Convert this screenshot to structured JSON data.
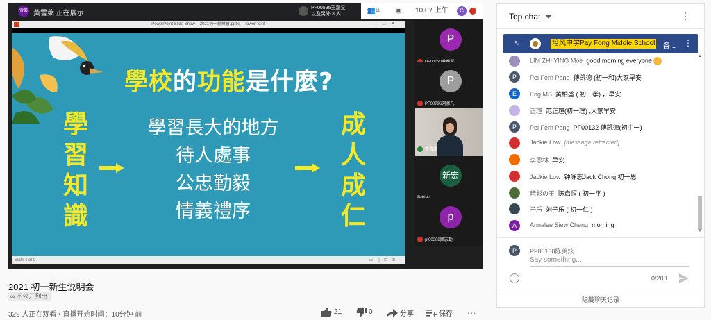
{
  "meet": {
    "presenter_avatar": "雪莱",
    "presenter_text": "黃雪萊 正在展示",
    "others_line1": "PF00596王嘉显",
    "others_line2": "以及另外 3 人",
    "people_count": "11",
    "time": "10:07 上午",
    "user_avatar": "C"
  },
  "ppt": {
    "window_title": "PowerPoint Slide Show - [2021初一新鲜會.pptx] - PowerPoint",
    "status_text": "Slide 4 of 9"
  },
  "slide": {
    "title_a": "學校",
    "title_b": "的",
    "title_c": "功能",
    "title_d": "是什麼?",
    "left_vertical": [
      "學",
      "習",
      "知",
      "識"
    ],
    "right_vertical": [
      "成",
      "人",
      "成",
      "仁"
    ],
    "lines": [
      "學習長大的地方",
      "待人處事",
      "公忠勤毅",
      "情義禮序"
    ],
    "accent_color": "#f3e928",
    "background_color": "#2f9ab7"
  },
  "tiles": [
    {
      "avatar": "P",
      "label": "PF00030蔡秀琴",
      "color": "#9c27b0"
    },
    {
      "avatar": "P",
      "label": "PF00796刘雅凡",
      "color": "#9e9e9e"
    },
    {
      "avatar": "",
      "label": "黃雪萊",
      "color": "#c9c3bd"
    },
    {
      "avatar": "新宏",
      "label": "陈新宏",
      "color": "#1b5e40"
    },
    {
      "avatar": "p",
      "label": "pf00368颜志勤",
      "color": "#8e24aa"
    }
  ],
  "video": {
    "title": "2021 初一新生说明会",
    "unlisted": "不公开列出",
    "stats": "329 人正在观看 • 直播开始时间：10分钟 前",
    "likes": "21",
    "dislikes": "0",
    "share": "分享",
    "save": "保存",
    "more": "⋯"
  },
  "chat": {
    "header": "Top chat",
    "pinned_author": "培风中学Pay Fong Middle School",
    "pinned_text": "各...",
    "messages": [
      {
        "author": "LIM ZHI YING Moe",
        "text": "good morning everyone",
        "avatar": "",
        "color": "#9a8fb8",
        "emoji": true
      },
      {
        "author": "Pei Fern Pang",
        "text": "傅凯德 (初一和)大家早安",
        "avatar": "P",
        "color": "#4a5568"
      },
      {
        "author": "Eng MS",
        "text": "黄柏盛 ( 初一孝) ，早安",
        "avatar": "E",
        "color": "#1565c0"
      },
      {
        "author": "正瑄",
        "text": "范正瑄(初一理) ,大家早安",
        "avatar": "",
        "color": "#c5b3e6"
      },
      {
        "author": "Pei Fern Pang",
        "text": "PF00132 傅凯德(初中一)",
        "avatar": "P",
        "color": "#4a5568"
      },
      {
        "author": "Jackie Low",
        "text": "[message retracted]",
        "avatar": "",
        "color": "#d32f2f",
        "retracted": true
      },
      {
        "author": "李恩林",
        "text": "早安",
        "avatar": "",
        "color": "#ef6c00"
      },
      {
        "author": "Jackie Low",
        "text": "钟咏志Jack Chong 初一恩",
        "avatar": "",
        "color": "#d32f2f"
      },
      {
        "author": "暗影の王",
        "text": "陈启恒 ( 初一平 )",
        "avatar": "",
        "color": "#4e6b3a"
      },
      {
        "author": "子乐",
        "text": "刘子乐 ( 初一仁 )",
        "avatar": "",
        "color": "#37474f"
      },
      {
        "author": "Annalee Siew Cheng",
        "text": "morning",
        "avatar": "A",
        "color": "#7b1fa2"
      }
    ],
    "composer_avatar": "P",
    "composer_name": "PF00130陈美炫",
    "placeholder": "Say something...",
    "counter": "0/200",
    "hide_chat": "隐藏聊天记录"
  }
}
